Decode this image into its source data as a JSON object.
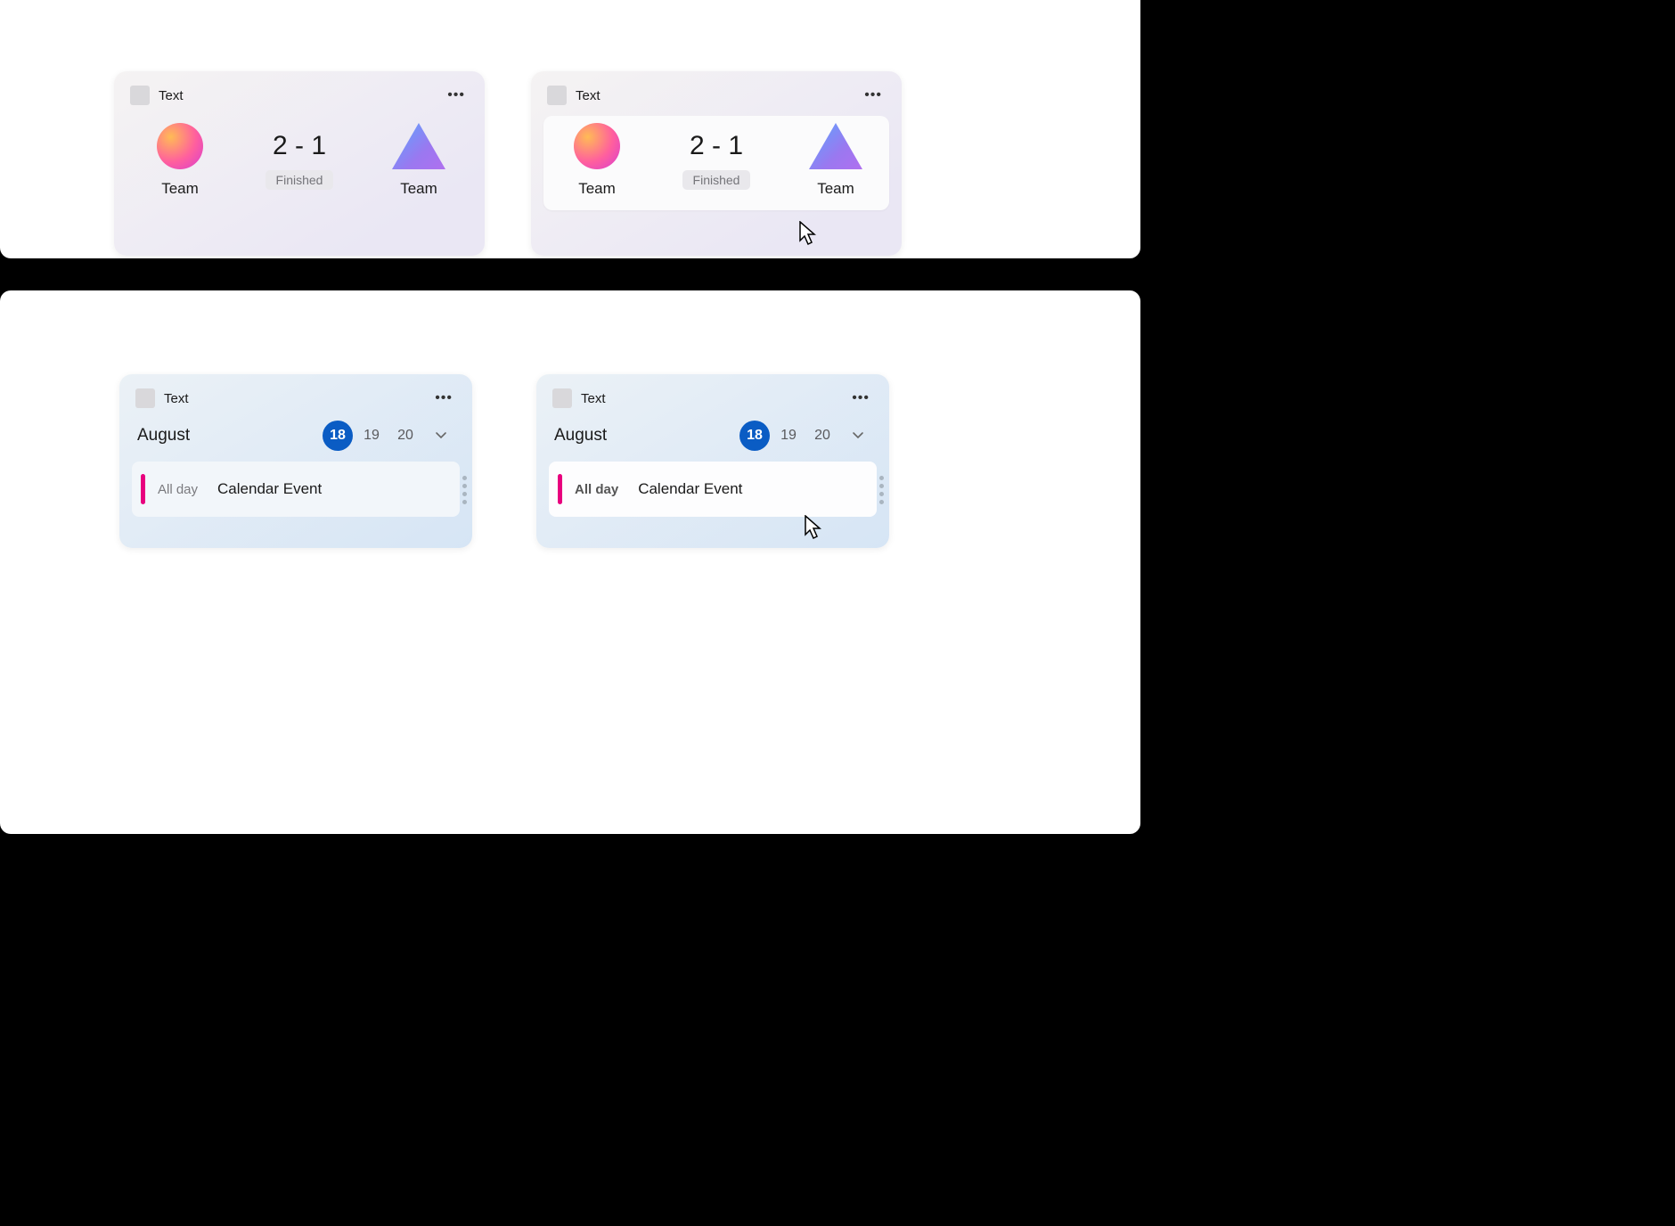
{
  "score_card": {
    "header_text": "Text",
    "team_a": "Team",
    "team_b": "Team",
    "score": "2 - 1",
    "status": "Finished"
  },
  "calendar_card": {
    "header_text": "Text",
    "month": "August",
    "days": [
      "18",
      "19",
      "20"
    ],
    "active_day": "18",
    "event_time": "All day",
    "event_title": "Calendar Event"
  }
}
